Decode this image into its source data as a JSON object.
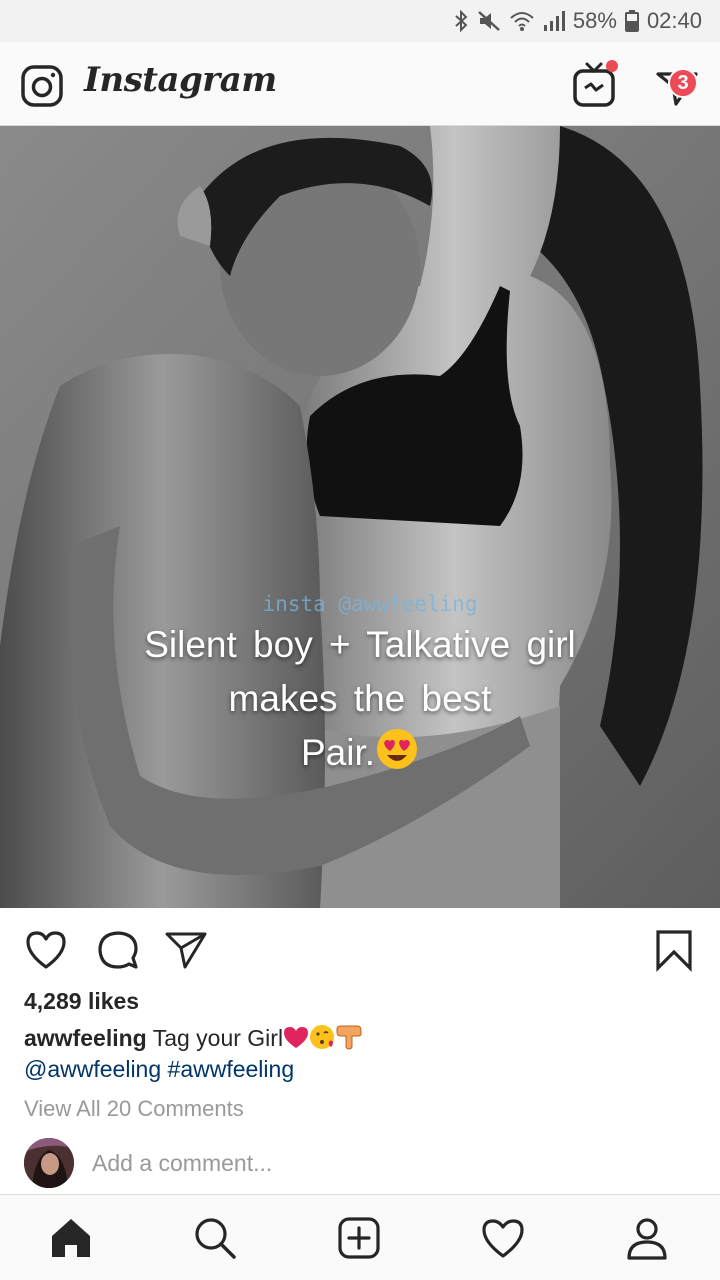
{
  "status_bar": {
    "battery": "58%",
    "time": "02:40",
    "icons": [
      "bluetooth-icon",
      "mute-icon",
      "wifi-icon",
      "signal-icon",
      "battery-icon"
    ]
  },
  "header": {
    "logo": "Instagram",
    "dm_badge_count": "3",
    "icons": [
      "camera-icon",
      "igtv-icon",
      "direct-message-icon"
    ]
  },
  "post": {
    "image_text": {
      "watermark": "insta @awwfeeling",
      "line1": "Silent boy + Talkative girl",
      "line2": "makes the best",
      "line3": "Pair."
    },
    "likes": "4,289 likes",
    "caption_user": "awwfeeling",
    "caption_text": "Tag your Girl",
    "caption_emojis": [
      "heart-emoji",
      "kissing-face-emoji",
      "pointing-down-emoji"
    ],
    "tags": "@awwfeeling #awwfeeling",
    "view_comments": "View All 20 Comments",
    "add_comment_placeholder": "Add a comment..."
  },
  "actions": [
    "like-icon",
    "comment-icon",
    "share-icon",
    "bookmark-icon"
  ],
  "bottom_nav": [
    "home-icon",
    "search-icon",
    "add-post-icon",
    "activity-icon",
    "profile-icon"
  ],
  "colors": {
    "badge": "#ed4956",
    "link": "#003569",
    "muted": "#999999"
  }
}
